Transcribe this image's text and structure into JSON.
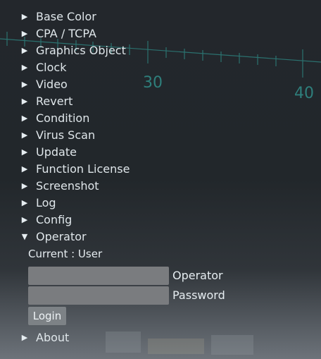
{
  "menu": {
    "items": [
      {
        "label": "Base Color",
        "arrow": "▶"
      },
      {
        "label": "CPA / TCPA",
        "arrow": "▶"
      },
      {
        "label": "Graphics Object",
        "arrow": "▶"
      },
      {
        "label": "Clock",
        "arrow": "▶"
      },
      {
        "label": "Video",
        "arrow": "▶"
      },
      {
        "label": "Revert",
        "arrow": "▶"
      },
      {
        "label": "Condition",
        "arrow": "▶"
      },
      {
        "label": "Virus Scan",
        "arrow": "▶"
      },
      {
        "label": "Update",
        "arrow": "▶"
      },
      {
        "label": "Function License",
        "arrow": "▶"
      },
      {
        "label": "Screenshot",
        "arrow": "▶"
      },
      {
        "label": "Log",
        "arrow": "▶"
      },
      {
        "label": "Config",
        "arrow": "▶"
      },
      {
        "label": "Operator",
        "arrow": "▼"
      }
    ],
    "about": {
      "label": "About",
      "arrow": "▶"
    }
  },
  "operator": {
    "current": "Current : User",
    "operator_label": "Operator",
    "password_label": "Password",
    "operator_value": "",
    "password_value": "",
    "login_label": "Login"
  },
  "background": {
    "scale_labels": [
      "30",
      "40"
    ],
    "accent_color": "#2f8f8c"
  }
}
